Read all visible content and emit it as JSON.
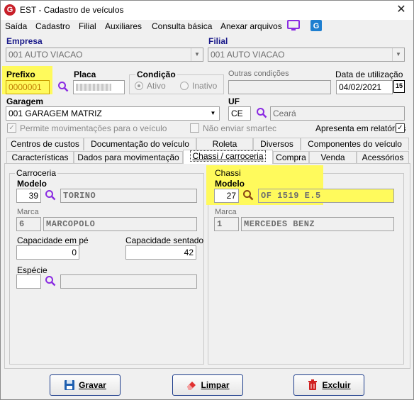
{
  "window": {
    "title": "EST - Cadastro de veículos"
  },
  "menu": {
    "items": [
      "Saída",
      "Cadastro",
      "Filial",
      "Auxiliares",
      "Consulta básica",
      "Anexar arquivos"
    ]
  },
  "header": {
    "empresa_label": "Empresa",
    "empresa_value": "001 AUTO VIACAO",
    "filial_label": "Filial",
    "filial_value": "001 AUTO VIACAO",
    "prefixo_label": "Prefixo",
    "prefixo_value": "0000001",
    "placa_label": "Placa",
    "condicao_label": "Condição",
    "condicao_ativo": "Ativo",
    "condicao_inativo": "Inativo",
    "outras_condicoes_label": "Outras condições",
    "data_utilizacao_label": "Data de utilização",
    "data_utilizacao_value": "04/02/2021",
    "calendar_day": "15",
    "garagem_label": "Garagem",
    "garagem_value": "001 GARAGEM MATRIZ",
    "uf_label": "UF",
    "uf_value": "CE",
    "uf_name": "Ceará",
    "permite_mov_label": "Permite movimentações para o veículo",
    "nao_enviar_label": "Não enviar smartec",
    "apresenta_label": "Apresenta em relatórios"
  },
  "tabs_row1": [
    "Centros de custos",
    "Documentação do veículo",
    "Roleta",
    "Diversos",
    "Componentes do veículo"
  ],
  "tabs_row2": [
    "Características",
    "Dados para movimentação",
    "Chassi / carroceria",
    "Compra",
    "Venda",
    "Acessórios"
  ],
  "carroceria": {
    "title": "Carroceria",
    "modelo_label": "Modelo",
    "modelo_code": "39",
    "modelo_name": "TORINO",
    "marca_label": "Marca",
    "marca_code": "6",
    "marca_name": "MARCOPOLO",
    "cap_pe_label": "Capacidade em pé",
    "cap_pe_value": "0",
    "cap_sentado_label": "Capacidade sentado",
    "cap_sentado_value": "42",
    "especie_label": "Espécie",
    "especie_code": "",
    "especie_name": ""
  },
  "chassi": {
    "title": "Chassi",
    "modelo_label": "Modelo",
    "modelo_code": "27",
    "modelo_name": "OF 1519 E.5",
    "marca_label": "Marca",
    "marca_code": "1",
    "marca_name": "MERCEDES BENZ"
  },
  "buttons": {
    "gravar": "Gravar",
    "limpar": "Limpar",
    "excluir": "Excluir"
  },
  "colors": {
    "highlight": "#fffa5c",
    "accent": "#8a2be2",
    "button_border": "#1a3a8a"
  }
}
